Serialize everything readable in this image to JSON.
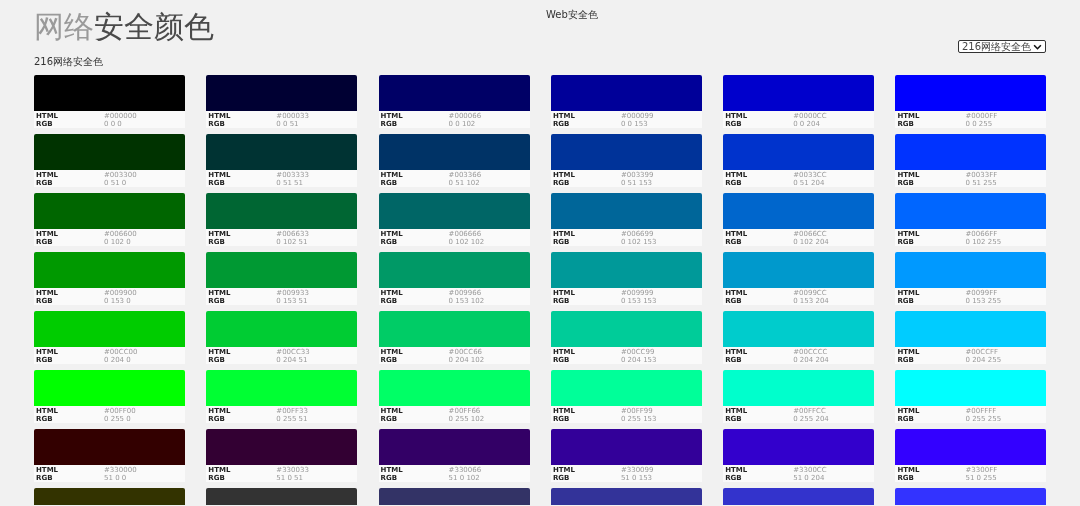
{
  "title": [
    {
      "text": "网络",
      "muted": true
    },
    {
      "text": "安全颜色",
      "muted": false
    }
  ],
  "header_center": "Web安全色",
  "dropdown": {
    "value": "216网络安全色"
  },
  "subtitle": "216网络安全色",
  "rows": [
    {
      "swatches": [
        {
          "color": "#000000",
          "html_label": "HTML",
          "html": "#000000",
          "rgb_label": "RGB",
          "rgb": "0 0 0"
        },
        {
          "color": "#000033",
          "html_label": "HTML",
          "html": "#000033",
          "rgb_label": "RGB",
          "rgb": "0 0 51"
        },
        {
          "color": "#000066",
          "html_label": "HTML",
          "html": "#000066",
          "rgb_label": "RGB",
          "rgb": "0 0 102"
        },
        {
          "color": "#000099",
          "html_label": "HTML",
          "html": "#000099",
          "rgb_label": "RGB",
          "rgb": "0 0 153"
        },
        {
          "color": "#0000cc",
          "html_label": "HTML",
          "html": "#0000CC",
          "rgb_label": "RGB",
          "rgb": "0 0 204"
        },
        {
          "color": "#0000ff",
          "html_label": "HTML",
          "html": "#0000FF",
          "rgb_label": "RGB",
          "rgb": "0 0 255"
        }
      ]
    },
    {
      "swatches": [
        {
          "color": "#003300",
          "html_label": "HTML",
          "html": "#003300",
          "rgb_label": "RGB",
          "rgb": "0 51 0"
        },
        {
          "color": "#003333",
          "html_label": "HTML",
          "html": "#003333",
          "rgb_label": "RGB",
          "rgb": "0 51 51"
        },
        {
          "color": "#003366",
          "html_label": "HTML",
          "html": "#003366",
          "rgb_label": "RGB",
          "rgb": "0 51 102"
        },
        {
          "color": "#003399",
          "html_label": "HTML",
          "html": "#003399",
          "rgb_label": "RGB",
          "rgb": "0 51 153"
        },
        {
          "color": "#0033cc",
          "html_label": "HTML",
          "html": "#0033CC",
          "rgb_label": "RGB",
          "rgb": "0 51 204"
        },
        {
          "color": "#0033ff",
          "html_label": "HTML",
          "html": "#0033FF",
          "rgb_label": "RGB",
          "rgb": "0 51 255"
        }
      ]
    },
    {
      "swatches": [
        {
          "color": "#006600",
          "html_label": "HTML",
          "html": "#006600",
          "rgb_label": "RGB",
          "rgb": "0 102 0"
        },
        {
          "color": "#006633",
          "html_label": "HTML",
          "html": "#006633",
          "rgb_label": "RGB",
          "rgb": "0 102 51"
        },
        {
          "color": "#006666",
          "html_label": "HTML",
          "html": "#006666",
          "rgb_label": "RGB",
          "rgb": "0 102 102"
        },
        {
          "color": "#006699",
          "html_label": "HTML",
          "html": "#006699",
          "rgb_label": "RGB",
          "rgb": "0 102 153"
        },
        {
          "color": "#0066cc",
          "html_label": "HTML",
          "html": "#0066CC",
          "rgb_label": "RGB",
          "rgb": "0 102 204"
        },
        {
          "color": "#0066ff",
          "html_label": "HTML",
          "html": "#0066FF",
          "rgb_label": "RGB",
          "rgb": "0 102 255"
        }
      ]
    },
    {
      "swatches": [
        {
          "color": "#009900",
          "html_label": "HTML",
          "html": "#009900",
          "rgb_label": "RGB",
          "rgb": "0 153 0"
        },
        {
          "color": "#009933",
          "html_label": "HTML",
          "html": "#009933",
          "rgb_label": "RGB",
          "rgb": "0 153 51"
        },
        {
          "color": "#009966",
          "html_label": "HTML",
          "html": "#009966",
          "rgb_label": "RGB",
          "rgb": "0 153 102"
        },
        {
          "color": "#009999",
          "html_label": "HTML",
          "html": "#009999",
          "rgb_label": "RGB",
          "rgb": "0 153 153"
        },
        {
          "color": "#0099cc",
          "html_label": "HTML",
          "html": "#0099CC",
          "rgb_label": "RGB",
          "rgb": "0 153 204"
        },
        {
          "color": "#0099ff",
          "html_label": "HTML",
          "html": "#0099FF",
          "rgb_label": "RGB",
          "rgb": "0 153 255"
        }
      ]
    },
    {
      "swatches": [
        {
          "color": "#00cc00",
          "html_label": "HTML",
          "html": "#00CC00",
          "rgb_label": "RGB",
          "rgb": "0 204 0"
        },
        {
          "color": "#00cc33",
          "html_label": "HTML",
          "html": "#00CC33",
          "rgb_label": "RGB",
          "rgb": "0 204 51"
        },
        {
          "color": "#00cc66",
          "html_label": "HTML",
          "html": "#00CC66",
          "rgb_label": "RGB",
          "rgb": "0 204 102"
        },
        {
          "color": "#00cc99",
          "html_label": "HTML",
          "html": "#00CC99",
          "rgb_label": "RGB",
          "rgb": "0 204 153"
        },
        {
          "color": "#00cccc",
          "html_label": "HTML",
          "html": "#00CCCC",
          "rgb_label": "RGB",
          "rgb": "0 204 204"
        },
        {
          "color": "#00ccff",
          "html_label": "HTML",
          "html": "#00CCFF",
          "rgb_label": "RGB",
          "rgb": "0 204 255"
        }
      ]
    },
    {
      "swatches": [
        {
          "color": "#00ff00",
          "html_label": "HTML",
          "html": "#00FF00",
          "rgb_label": "RGB",
          "rgb": "0 255 0"
        },
        {
          "color": "#00ff33",
          "html_label": "HTML",
          "html": "#00FF33",
          "rgb_label": "RGB",
          "rgb": "0 255 51"
        },
        {
          "color": "#00ff66",
          "html_label": "HTML",
          "html": "#00FF66",
          "rgb_label": "RGB",
          "rgb": "0 255 102"
        },
        {
          "color": "#00ff99",
          "html_label": "HTML",
          "html": "#00FF99",
          "rgb_label": "RGB",
          "rgb": "0 255 153"
        },
        {
          "color": "#00ffcc",
          "html_label": "HTML",
          "html": "#00FFCC",
          "rgb_label": "RGB",
          "rgb": "0 255 204"
        },
        {
          "color": "#00ffff",
          "html_label": "HTML",
          "html": "#00FFFF",
          "rgb_label": "RGB",
          "rgb": "0 255 255"
        }
      ]
    },
    {
      "swatches": [
        {
          "color": "#330000",
          "html_label": "HTML",
          "html": "#330000",
          "rgb_label": "RGB",
          "rgb": "51 0 0"
        },
        {
          "color": "#330033",
          "html_label": "HTML",
          "html": "#330033",
          "rgb_label": "RGB",
          "rgb": "51 0 51"
        },
        {
          "color": "#330066",
          "html_label": "HTML",
          "html": "#330066",
          "rgb_label": "RGB",
          "rgb": "51 0 102"
        },
        {
          "color": "#330099",
          "html_label": "HTML",
          "html": "#330099",
          "rgb_label": "RGB",
          "rgb": "51 0 153"
        },
        {
          "color": "#3300cc",
          "html_label": "HTML",
          "html": "#3300CC",
          "rgb_label": "RGB",
          "rgb": "51 0 204"
        },
        {
          "color": "#3300ff",
          "html_label": "HTML",
          "html": "#3300FF",
          "rgb_label": "RGB",
          "rgb": "51 0 255"
        }
      ]
    },
    {
      "swatches": [
        {
          "color": "#333300"
        },
        {
          "color": "#333333"
        },
        {
          "color": "#333366"
        },
        {
          "color": "#333399"
        },
        {
          "color": "#3333cc"
        },
        {
          "color": "#3333ff"
        }
      ]
    }
  ]
}
